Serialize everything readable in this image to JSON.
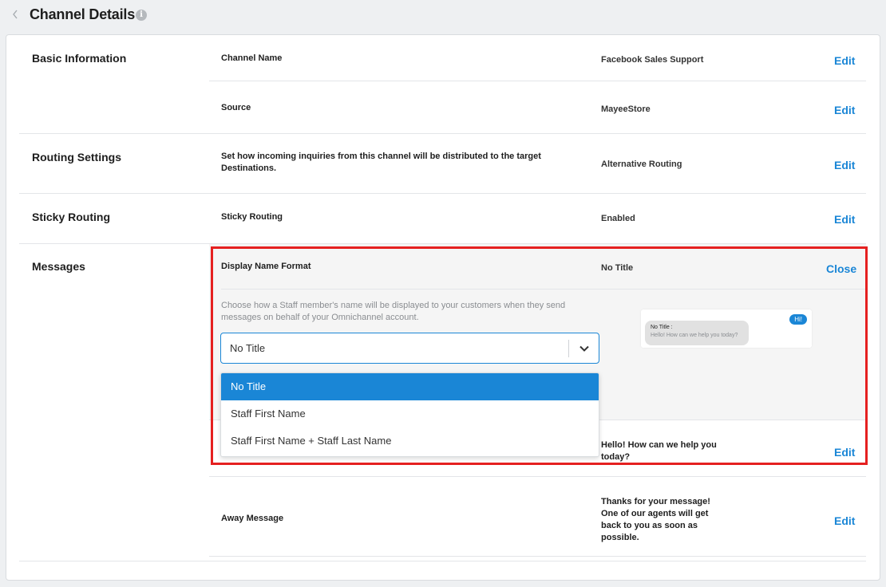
{
  "header": {
    "title": "Channel Details"
  },
  "basic": {
    "title": "Basic Information",
    "channel_name_label": "Channel Name",
    "channel_name_value": "Facebook Sales Support",
    "source_label": "Source",
    "source_value": "MayeeStore"
  },
  "routing": {
    "title": "Routing Settings",
    "label_line1": "Set how incoming inquiries from this channel will be distributed to the target",
    "label_line2": "Destinations.",
    "value": "Alternative Routing"
  },
  "sticky": {
    "title": "Sticky Routing",
    "label": "Sticky Routing",
    "value": "Enabled"
  },
  "messages": {
    "title": "Messages",
    "display_label": "Display Name Format",
    "display_value": "No Title",
    "close_label": "Close",
    "help_line1": "Choose how a Staff member's name will be displayed to your customers when they send",
    "help_line2": "messages on behalf of your Omnichannel account.",
    "select_value": "No Title",
    "options": [
      "No Title",
      "Staff First Name",
      "Staff First Name + Staff Last Name"
    ],
    "preview_hi": "Hi!",
    "preview_name": "No Title :",
    "preview_text": "Hello! How can we help you today?",
    "greeting_line1": "Hello! How can we help you",
    "greeting_line2": "today?",
    "away_label": "Away Message",
    "away_line1": "Thanks for your message!",
    "away_line2": "One of our agents will get",
    "away_line3": "back to you as soon as",
    "away_line4": "possible."
  },
  "common": {
    "edit_label": "Edit"
  },
  "colors": {
    "accent": "#1a86d6",
    "highlight": "#e52020"
  }
}
